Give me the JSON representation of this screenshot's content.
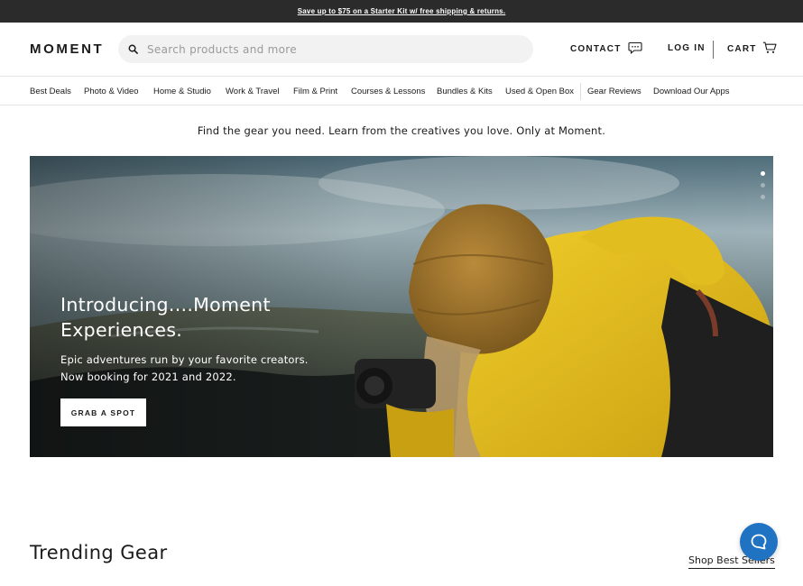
{
  "promo": {
    "text": "Save up to $75 on a Starter Kit w/ free shipping & returns."
  },
  "header": {
    "logo": "MOMENT",
    "search_placeholder": "Search products and more",
    "contact_label": "CONTACT",
    "login_label": "LOG IN",
    "cart_label": "CART",
    "icons": {
      "search": "search-icon",
      "contact": "chat-bubble-icon",
      "cart": "cart-icon"
    }
  },
  "nav": {
    "items": [
      {
        "label": "Best Deals"
      },
      {
        "label": "Photo & Video"
      },
      {
        "label": "Home & Studio"
      },
      {
        "label": "Work & Travel"
      },
      {
        "label": "Film & Print"
      },
      {
        "label": "Courses & Lessons"
      },
      {
        "label": "Bundles & Kits"
      },
      {
        "label": "Used & Open Box"
      },
      {
        "label": "Gear Reviews"
      },
      {
        "label": "Download Our Apps"
      }
    ]
  },
  "tagline": "Find the gear you need. Learn from the creatives you love. Only at Moment.",
  "hero": {
    "title": "Introducing....Moment Experiences.",
    "subtitle": "Epic adventures run by your favorite creators. Now booking for 2021 and 2022.",
    "button_label": "GRAB A SPOT",
    "slide_count": 3,
    "active_slide": 1
  },
  "trending": {
    "title": "Trending Gear",
    "link_label": "Shop Best Sellers"
  },
  "chat_widget": {
    "icon": "chat-icon",
    "color": "#1f73c2"
  },
  "colors": {
    "promo_bg": "#2b2b2b",
    "accent_blue": "#1f73c2",
    "jacket_yellow": "#e8c21a",
    "beanie_brown": "#a87a2e"
  }
}
